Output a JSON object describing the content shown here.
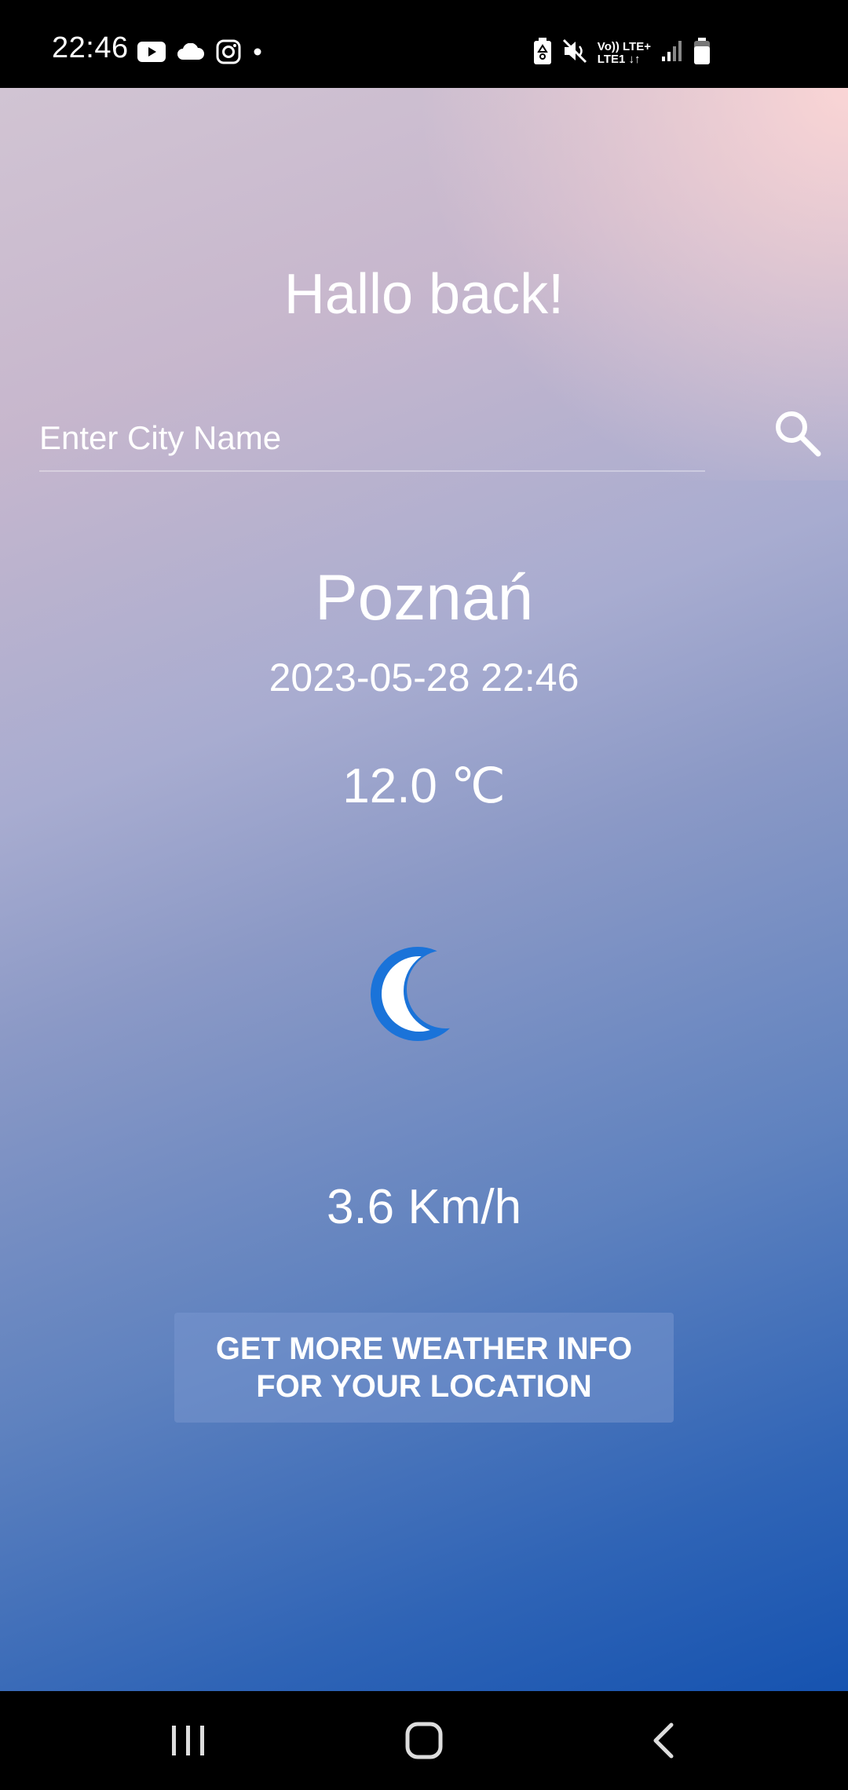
{
  "status_bar": {
    "time": "22:46",
    "icons_left": [
      "youtube-icon",
      "cloud-icon",
      "instagram-icon",
      "dot-icon"
    ],
    "icons_right": [
      "battery-saver-icon",
      "mute-icon",
      "volte-lte-icon",
      "signal-icon",
      "battery-icon"
    ],
    "volte_line1": "Vo)) LTE+",
    "volte_line2": "LTE1 ↓↑"
  },
  "app": {
    "greeting": "Hallo back!",
    "search": {
      "placeholder": "Enter City Name",
      "value": ""
    },
    "city": "Poznań",
    "datetime": "2023-05-28 22:46",
    "temperature": "12.0 ℃",
    "weather_icon": "moon-icon",
    "wind": "3.6 Km/h",
    "more_button_line1": "GET MORE WEATHER INFO",
    "more_button_line2": "FOR YOUR LOCATION"
  },
  "colors": {
    "gradient_top": "#d1c4d3",
    "gradient_bottom": "#1653b0",
    "moon_blue": "#1a73d9"
  },
  "nav_bar": {
    "buttons": [
      "recent-apps-icon",
      "home-icon",
      "back-icon"
    ]
  }
}
